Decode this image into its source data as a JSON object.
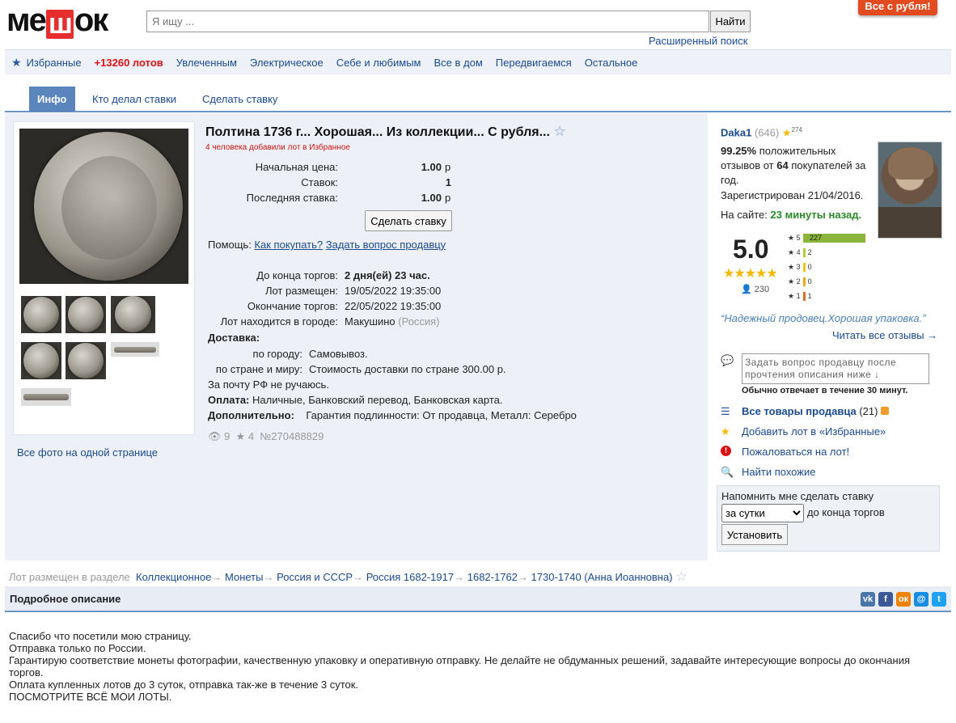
{
  "header": {
    "logo": "мешок",
    "search_placeholder": "Я ищу ...",
    "find_label": "Найти",
    "advanced_search": "Расширенный поиск",
    "promo": "Все с рубля!"
  },
  "catnav": {
    "favorites": "Избранные",
    "lots": "+13260 лотов",
    "items": [
      "Увлеченным",
      "Электрическое",
      "Себе и любимым",
      "Все в дом",
      "Передвигаемся",
      "Остальное"
    ]
  },
  "tabs": [
    "Инфо",
    "Кто делал ставки",
    "Сделать ставку"
  ],
  "photos": {
    "all_photos": "Все фото на одной странице"
  },
  "lot": {
    "title": "Полтина 1736 г... Хорошая... Из коллекции... С рубля...",
    "fav_note": "4 человека добавили лот в Избранное",
    "start_price_label": "Начальная цена:",
    "start_price": "1.00",
    "bids_label": "Ставок:",
    "bids": "1",
    "last_bid_label": "Последняя ставка:",
    "last_bid": "1.00",
    "currency": "р",
    "bid_button": "Сделать ставку",
    "help_label": "Помощь:",
    "help_how": "Как покупать?",
    "help_ask": "Задать вопрос продавцу",
    "ends_in_label": "До конца торгов:",
    "ends_in": "2 дня(ей) 23 час.",
    "placed_label": "Лот размещен:",
    "placed": "19/05/2022 19:35:00",
    "end_label": "Окончание торгов:",
    "end": "22/05/2022 19:35:00",
    "city_label": "Лот находится в городе:",
    "city": "Макушино",
    "country": "(Россия)",
    "delivery_label": "Доставка:",
    "city_delivery_label": "по городу:",
    "city_delivery": "Самовывоз.",
    "world_delivery_label": "по стране и миру:",
    "world_delivery": "Стоимость доставки по стране 300.00 р.",
    "post_note": "За почту РФ не ручаюсь.",
    "payment_label": "Оплата:",
    "payment": "Наличные, Банковский перевод, Банковская карта.",
    "extra_label": "Дополнительно:",
    "extra": "Гарантия подлинности: От продавца, Металл: Серебро",
    "views": "9",
    "stars": "4",
    "lot_number": "№270488829"
  },
  "seller": {
    "name": "Daka1",
    "count": "(646)",
    "star_count": "274",
    "positive_pct": "99.25%",
    "positive_text_1": "положительных",
    "positive_text_2": "отзывов от",
    "buyers": "64",
    "positive_text_3": "покупателей за",
    "positive_text_4": "год.",
    "registered": "Зарегистрирован 21/04/2016.",
    "online_label": "На сайте:",
    "online": "23 минуты назад.",
    "rating": "5.0",
    "rating_votes": "230",
    "bars": [
      {
        "star": "5",
        "count": "227",
        "fraction": 0.987,
        "color": "#8ab43a"
      },
      {
        "star": "4",
        "count": "2",
        "fraction": 0.009,
        "color": "#b8cc3a"
      },
      {
        "star": "3",
        "count": "0",
        "fraction": 0.0,
        "color": "#f0c419"
      },
      {
        "star": "2",
        "count": "0",
        "fraction": 0.0,
        "color": "#f0a419"
      },
      {
        "star": "1",
        "count": "1",
        "fraction": 0.004,
        "color": "#e06a2a"
      }
    ],
    "review_quote": "“Надежный продовец.Хорошая упаковка.”",
    "all_reviews": "Читать все отзывы →",
    "question_placeholder": "Задать вопрос продавцу после прочтения описания ниже ↓",
    "response_note": "Обычно отвечает в течение 30 минут.",
    "all_goods": "Все товары продавца",
    "all_goods_count": "(21)",
    "add_fav": "Добавить лот в «Избранные»",
    "complain": "Пожаловаться на лот!",
    "find_similar": "Найти похожие"
  },
  "remind": {
    "label": "Напомнить мне сделать ставку",
    "selected": "за сутки",
    "suffix": "до конца торгов",
    "button": "Установить"
  },
  "breadcrumb": {
    "label": "Лот размещен в разделе",
    "items": [
      "Коллекционное",
      "Монеты",
      "Россия и СССР",
      "Россия 1682-1917",
      "1682-1762",
      "1730-1740 (Анна Иоанновна)"
    ]
  },
  "description": {
    "heading": "Подробное описание",
    "lines": [
      "Спасибо что посетили мою страницу.",
      "Отправка только по России.",
      "Гарантирую соответствие монеты фотографии, качественную упаковку и оперативную отправку. Не делайте не обдуманных решений, задавайте интересующие вопросы до окончания торгов.",
      "Оплата купленных лотов до 3 суток, отправка так-же в течение 3 суток.",
      "ПОСМОТРИТЕ ВСЁ МОИ ЛОТЫ."
    ]
  },
  "social": [
    "vk",
    "f",
    "ok",
    "mail",
    "twitter"
  ]
}
